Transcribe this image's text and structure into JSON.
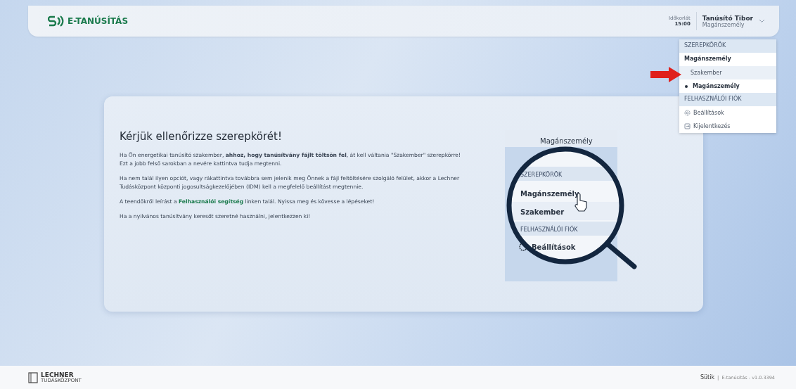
{
  "header": {
    "logo_text": "E-TANÚSÍTÁS",
    "time_limit_label": "Időkorlát",
    "time_limit_value": "15:00",
    "user_name": "Tanúsító Tibor",
    "user_role": "Magánszemély"
  },
  "dropdown": {
    "sections": [
      {
        "title": "SZEREPKÖRÖK",
        "group_label": "Magánszemély",
        "items": [
          {
            "label": "Szakember",
            "kind": "role",
            "selected": false,
            "highlighted": true
          },
          {
            "label": "Magánszemély",
            "kind": "role",
            "selected": true,
            "highlighted": false
          }
        ]
      },
      {
        "title": "FELHASZNÁLÓI FIÓK",
        "items": [
          {
            "label": "Beállítások",
            "kind": "settings",
            "selected": false,
            "highlighted": false
          },
          {
            "label": "Kijelentkezés",
            "kind": "logout",
            "selected": false,
            "highlighted": false
          }
        ]
      }
    ]
  },
  "card": {
    "title": "Kérjük ellenőrizze szerepkörét!",
    "paragraphs": [
      {
        "lines": [
          "Ha Ön energetikai tanúsító szakember, **ahhoz, hogy tanúsítvány fájlt töltsön fel**, át kell váltania \"Szakember\" szerepkörre!",
          "Ezt a jobb felső sarokban a nevére kattintva tudja megtenni."
        ]
      },
      {
        "lines": [
          "Ha nem talál ilyen opciót, vagy rákattintva továbbra sem jelenik meg Önnek a fájl feltöltésére szolgáló felület, akkor a Lechner Tudásközpont központi jogosultságkezelőjében (IDM) kell a megfelelő beállítást megtennie."
        ]
      },
      {
        "before": "A teendőkről leírást a ",
        "link": "Felhasználói segítség",
        "after": " linken talál. Nyissa meg és kövesse a lépéseket!"
      },
      {
        "lines": [
          "Ha a nyilvános tanúsítvány keresőt szeretné használni, jelentkezzen ki!"
        ]
      }
    ],
    "illustration": {
      "role": "Magánszemély",
      "section_title": "SZEREPKÖRÖK",
      "items": [
        "Magánszemély",
        "Szakember"
      ],
      "section_title_2": "FELHASZNÁLÓI FIÓK",
      "settings": "Beállítások"
    }
  },
  "footer": {
    "logo_text": "LECHNER",
    "logo_sub": "TUDÁSKÖZPONT",
    "cookies": "Sütik",
    "separator": "|",
    "version": "E-tanúsítás - v1.0.3394"
  }
}
